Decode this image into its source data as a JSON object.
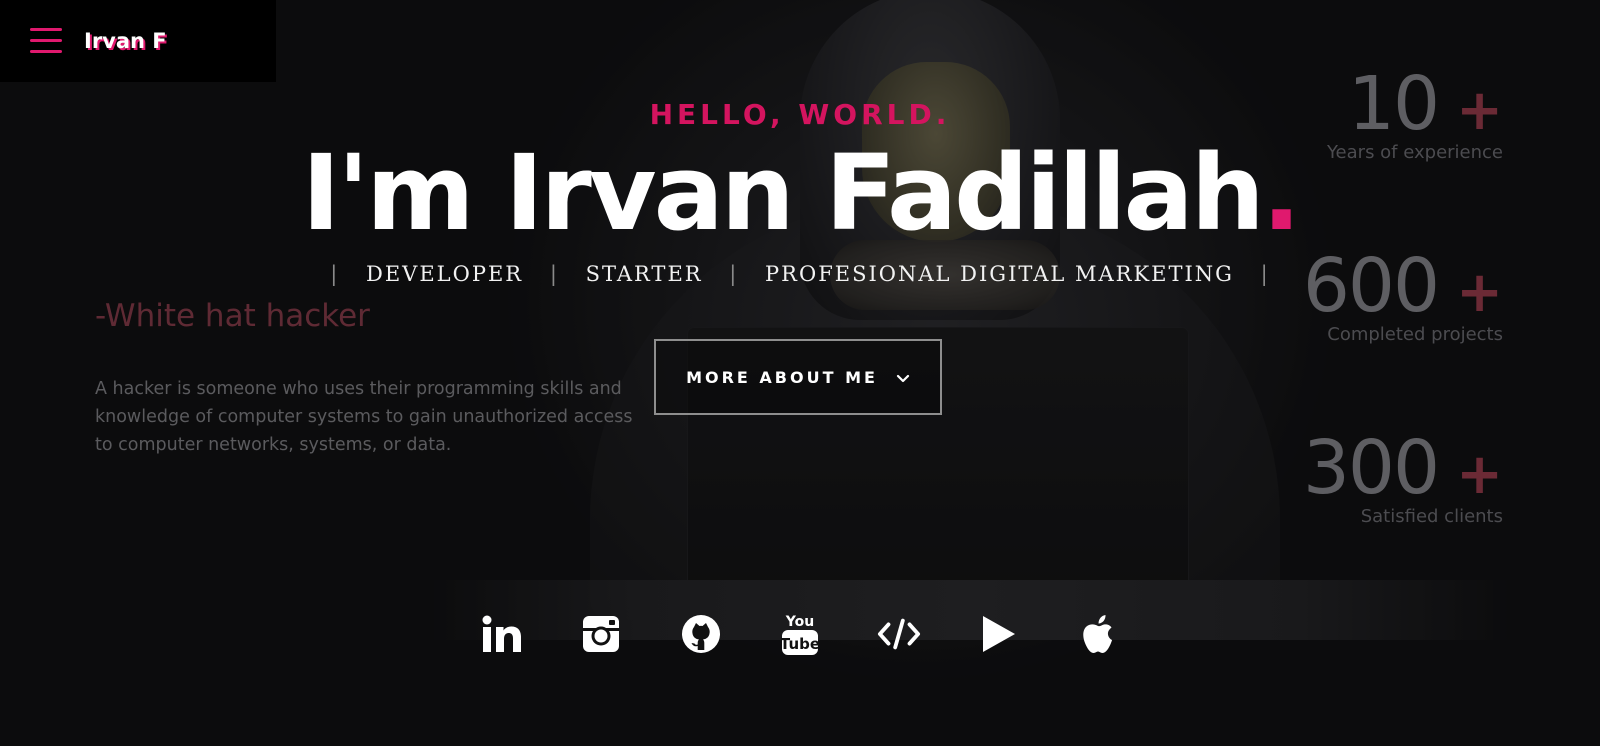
{
  "nav": {
    "brand": "Irvan F"
  },
  "hero": {
    "greeting": "HELLO, WORLD.",
    "title": "I'm Irvan Fadillah",
    "title_dot": ".",
    "roles": [
      "DEVELOPER",
      "STARTER",
      "PROFESIONAL DIGITAL MARKETING"
    ],
    "separator": "|",
    "cta_label": "MORE ABOUT ME"
  },
  "intro": {
    "tagline": "-White hat hacker",
    "description": "A hacker is someone who uses their programming skills and knowledge of computer systems to gain unauthorized access to computer networks, systems, or data."
  },
  "stats": [
    {
      "value": "10",
      "suffix": "+",
      "label": "Years of experience"
    },
    {
      "value": "600",
      "suffix": "+",
      "label": "Completed projects"
    },
    {
      "value": "300",
      "suffix": "+",
      "label": "Satisfied clients"
    }
  ],
  "social": [
    {
      "icon": "linkedin-icon"
    },
    {
      "icon": "instagram-icon"
    },
    {
      "icon": "github-icon"
    },
    {
      "icon": "youtube-icon"
    },
    {
      "icon": "code-icon"
    },
    {
      "icon": "play-store-icon"
    },
    {
      "icon": "apple-icon"
    }
  ],
  "colors": {
    "accent": "#e0196e",
    "background": "#0d0d0f",
    "text": "#ffffff"
  }
}
